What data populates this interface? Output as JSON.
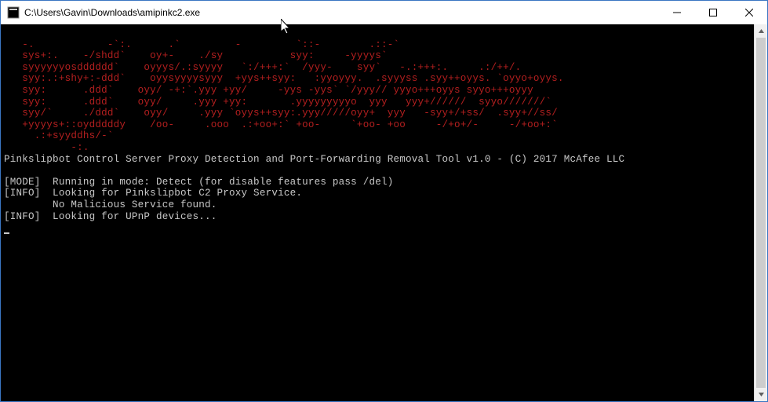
{
  "window": {
    "title": "C:\\Users\\Gavin\\Downloads\\amipinkc2.exe",
    "controls": {
      "minimize": "–",
      "maximize": "☐",
      "close": "✕"
    }
  },
  "ascii_art": [
    "   -.            -`:.      .`         -         `::-        .::-`",
    "   sys+:.    -/shdd`    oy+-    ./sy           syy:     -yyyys`",
    "   syyyyyyosdddddd`    oyyys/.:syyyy   `:/+++:`  /yyy-    syy`   -.:+++:.     .:/++/.",
    "   syy:.:+shy+:-ddd`    oyysyyyysyyy  +yys++syy:   :yyoyyy.  .syyyss .syy++oyys. `oyyo+oyys.",
    "   syy:      .ddd`    oyy/ -+:`.yyy +yy/     -yys -yys` `/yyy// yyyo+++oyys syyo+++oyyy",
    "   syy:      .ddd`    oyy/     .yyy +yy:       .yyyyyyyyyo  yyy   yyy+//////  syyo///////`",
    "   syy/`     ./ddd`    oyy/     .yyy `oyys++syy:.yyy/////oyy+  yyy   -syy+/+ss/  .syy+//ss/",
    "   +yyyys+::oydddddy    /oo-     .ooo  .:+oo+:` +oo-     `+oo- +oo     -/+o+/-     -/+oo+:`",
    "     .:+syyddhs/-`",
    "           -:."
  ],
  "lines": {
    "banner": "Pinkslipbot Control Server Proxy Detection and Port-Forwarding Removal Tool v1.0 - (C) 2017 McAfee LLC",
    "l1_tag": "[MODE]",
    "l1_text": "  Running in mode: Detect (for disable features pass /del)",
    "l2_tag": "[INFO]",
    "l2_text": "  Looking for Pinkslipbot C2 Proxy Service.",
    "l3_text": "        No Malicious Service found.",
    "l4_tag": "[INFO]",
    "l4_text": "  Looking for UPnP devices..."
  }
}
